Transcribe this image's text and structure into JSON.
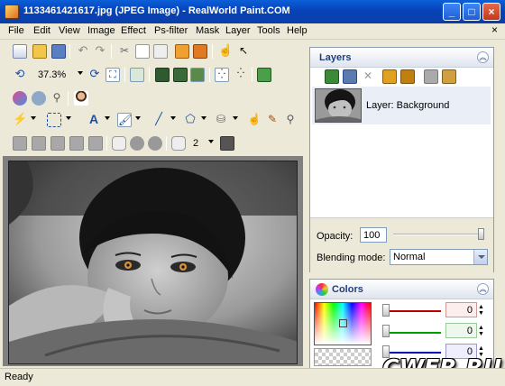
{
  "window": {
    "title": "1133461421617.jpg (JPEG Image) - RealWorld Paint.COM"
  },
  "menu": [
    "File",
    "Edit",
    "View",
    "Image",
    "Effect",
    "Ps-filter",
    "Mask",
    "Layer",
    "Tools",
    "Help"
  ],
  "toolbar": {
    "zoom": "37.3%",
    "line_width": "2"
  },
  "layers_panel": {
    "title": "Layers",
    "layer_name": "Layer: Background",
    "opacity_label": "Opacity:",
    "opacity_value": "100",
    "blending_label": "Blending mode:",
    "blending_value": "Normal"
  },
  "colors_panel": {
    "title": "Colors",
    "channels": [
      {
        "value": "0",
        "color": "#c00000"
      },
      {
        "value": "0",
        "color": "#00a000"
      },
      {
        "value": "0",
        "color": "#0000c0"
      }
    ]
  },
  "status": {
    "text": "Ready"
  },
  "watermark": "CWER.RU"
}
